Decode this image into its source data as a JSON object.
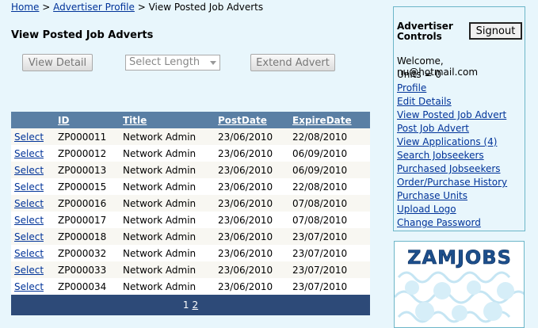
{
  "breadcrumb": {
    "home": "Home",
    "sep1": " > ",
    "profile": "Advertiser Profile",
    "sep2": " > ",
    "current": "View Posted Job Adverts"
  },
  "page_title": "View Posted Job Adverts",
  "toolbar": {
    "view_detail": "View Detail",
    "select_length": "Select Length",
    "extend_advert": "Extend Advert"
  },
  "table": {
    "headers": [
      "",
      "ID",
      "Title",
      "PostDate",
      "ExpireDate"
    ],
    "select_label": "Select",
    "rows": [
      {
        "id": "ZP000011",
        "title": "Network Admin",
        "post": "23/06/2010",
        "expire": "22/08/2010"
      },
      {
        "id": "ZP000012",
        "title": "Network Admin",
        "post": "23/06/2010",
        "expire": "06/09/2010"
      },
      {
        "id": "ZP000013",
        "title": "Network Admin",
        "post": "23/06/2010",
        "expire": "06/09/2010"
      },
      {
        "id": "ZP000015",
        "title": "Network Admin",
        "post": "23/06/2010",
        "expire": "22/08/2010"
      },
      {
        "id": "ZP000016",
        "title": "Network Admin",
        "post": "23/06/2010",
        "expire": "07/08/2010"
      },
      {
        "id": "ZP000017",
        "title": "Network Admin",
        "post": "23/06/2010",
        "expire": "07/08/2010"
      },
      {
        "id": "ZP000018",
        "title": "Network Admin",
        "post": "23/06/2010",
        "expire": "23/07/2010"
      },
      {
        "id": "ZP000032",
        "title": "Network Admin",
        "post": "23/06/2010",
        "expire": "23/07/2010"
      },
      {
        "id": "ZP000033",
        "title": "Network Admin",
        "post": "23/06/2010",
        "expire": "23/07/2010"
      },
      {
        "id": "ZP000034",
        "title": "Network Admin",
        "post": "23/06/2010",
        "expire": "23/07/2010"
      }
    ],
    "pager": {
      "current": "1",
      "next": "2"
    }
  },
  "controls": {
    "title_line1": "Advertiser",
    "title_line2": "Controls",
    "signout": "Signout",
    "welcome": "Welcome, nu@hotmail.com",
    "units": "Units = 0",
    "menu": [
      "Profile",
      "Edit Details",
      "View Posted Job Advert",
      "Post Job Advert",
      "View Applications (4)",
      "Search Jobseekers",
      "Purchased Jobseekers",
      "Order/Purchase History",
      "Purchase Units",
      "Upload Logo",
      "Change Password"
    ]
  },
  "logo": {
    "text": "ZAMJOBS"
  },
  "colors": {
    "page_bg": "#e8f6fc",
    "link": "#003399",
    "table_header": "#5a7fa4",
    "pager_bar": "#2d4a78",
    "panel_border": "#6cb6c8",
    "logo_blue": "#1d4f8c"
  }
}
